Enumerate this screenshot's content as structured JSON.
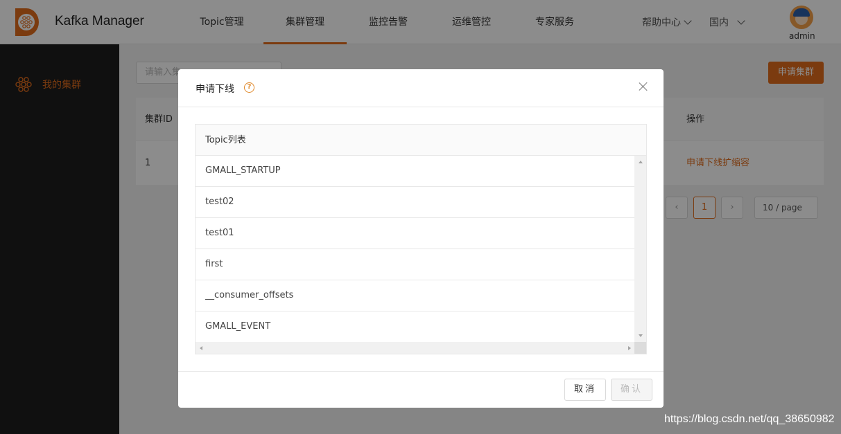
{
  "app": {
    "title": "Kafka Manager",
    "brand_color": "#e06c1c"
  },
  "nav": [
    {
      "label": "Topic管理",
      "active": false
    },
    {
      "label": "集群管理",
      "active": true
    },
    {
      "label": "监控告警",
      "active": false
    },
    {
      "label": "运维管控",
      "active": false
    },
    {
      "label": "专家服务",
      "active": false
    }
  ],
  "header": {
    "help_label": "帮助中心",
    "region_label": "国内",
    "user_name": "admin"
  },
  "sidebar": {
    "items": [
      {
        "label": "我的集群",
        "icon": "cluster-icon",
        "active": true
      }
    ]
  },
  "toolbar": {
    "search_placeholder": "请输入集",
    "apply_label": "申请集群"
  },
  "cluster_table": {
    "headers": {
      "id": "集群ID",
      "actions": "操作"
    },
    "rows": [
      {
        "id": "1",
        "action_offline": "申请下线",
        "action_scale": "扩缩容"
      }
    ]
  },
  "pagination": {
    "current_page": "1",
    "page_size_label": "10 / page"
  },
  "modal": {
    "title": "申请下线",
    "list_header": "Topic列表",
    "topics": [
      "GMALL_STARTUP",
      "test02",
      "test01",
      "first",
      "__consumer_offsets",
      "GMALL_EVENT"
    ],
    "cancel_label": "取消",
    "ok_label": "确认"
  },
  "watermark": "https://blog.csdn.net/qq_38650982"
}
